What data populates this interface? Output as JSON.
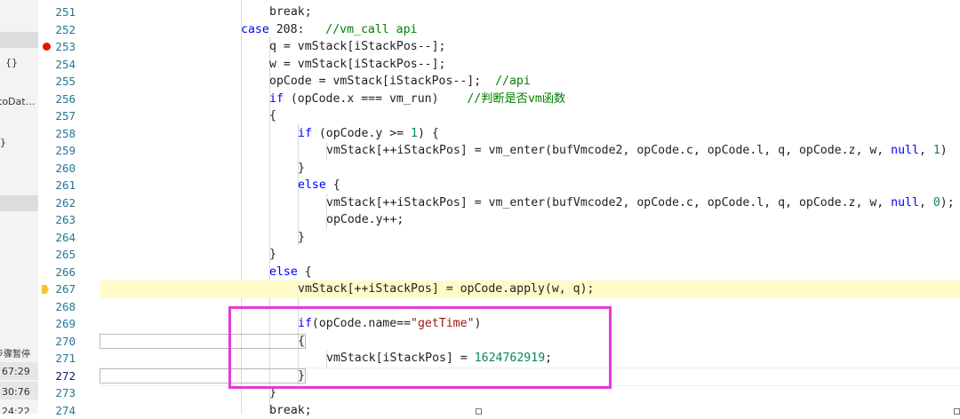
{
  "left_panel": {
    "texts": [
      {
        "name": "left-braces-1",
        "text": "{}"
      },
      {
        "name": "left-protodata",
        "text": "toDat…"
      },
      {
        "name": "left-brace-close",
        "text": "}"
      },
      {
        "name": "left-stepping-label",
        "text": "步骤暂停"
      },
      {
        "name": "left-time-1",
        "text": "67:29"
      },
      {
        "name": "left-time-2",
        "text": "30:76"
      },
      {
        "name": "left-time-3",
        "text": "24:22"
      }
    ]
  },
  "gutter": {
    "lines": [
      "251",
      "252",
      "253",
      "254",
      "255",
      "256",
      "257",
      "258",
      "259",
      "260",
      "261",
      "262",
      "263",
      "264",
      "265",
      "266",
      "267",
      "268",
      "269",
      "270",
      "271",
      "272",
      "273",
      "274"
    ]
  },
  "code": {
    "l251": {
      "a": "break;"
    },
    "l252": {
      "kw": "case",
      "num": " 208:",
      "cm": "   //vm_call api"
    },
    "l253": {
      "t": "q = vmStack[iStackPos--];"
    },
    "l254": {
      "t": "w = vmStack[iStackPos--];"
    },
    "l255": {
      "t": "opCode = vmStack[iStackPos--];  ",
      "cm": "//api"
    },
    "l256": {
      "kw": "if",
      "t": " (opCode.x === vm_run)    ",
      "cm": "//判断是否vm函数"
    },
    "l257": {
      "t": "{"
    },
    "l258": {
      "kw": "if",
      "t": " (opCode.y >= ",
      "num": "1",
      "t2": ") {"
    },
    "l259": {
      "t": "vmStack[++iStackPos] = vm_enter(bufVmcode2, opCode.c, opCode.l, q, opCode.z, w, ",
      "kw": "null",
      "t2": ", ",
      "num": "1",
      "t3": ")"
    },
    "l260": {
      "t": "}"
    },
    "l261": {
      "kw": "else",
      "t": " {"
    },
    "l262": {
      "t": "vmStack[++iStackPos] = vm_enter(bufVmcode2, opCode.c, opCode.l, q, opCode.z, w, ",
      "kw": "null",
      "t2": ", ",
      "num": "0",
      "t3": ");"
    },
    "l263": {
      "t": "opCode.y++;"
    },
    "l264": {
      "t": "}"
    },
    "l265": {
      "t": "}"
    },
    "l266": {
      "kw": "else",
      "t": " {"
    },
    "l267": {
      "t": "vmStack[++iStackPos] = opCode.apply(w, q);"
    },
    "l268": {
      "t": ""
    },
    "l269": {
      "kw": "if",
      "t": "(opCode.name==",
      "st": "\"getTime\"",
      "t2": ")"
    },
    "l270": {
      "t": "{"
    },
    "l271": {
      "t": "vmStack[iStackPos] = ",
      "num": "1624762919",
      "t2": ";"
    },
    "l272": {
      "t": "}"
    },
    "l273": {
      "t": "}"
    },
    "l274": {
      "t": "break;"
    }
  }
}
